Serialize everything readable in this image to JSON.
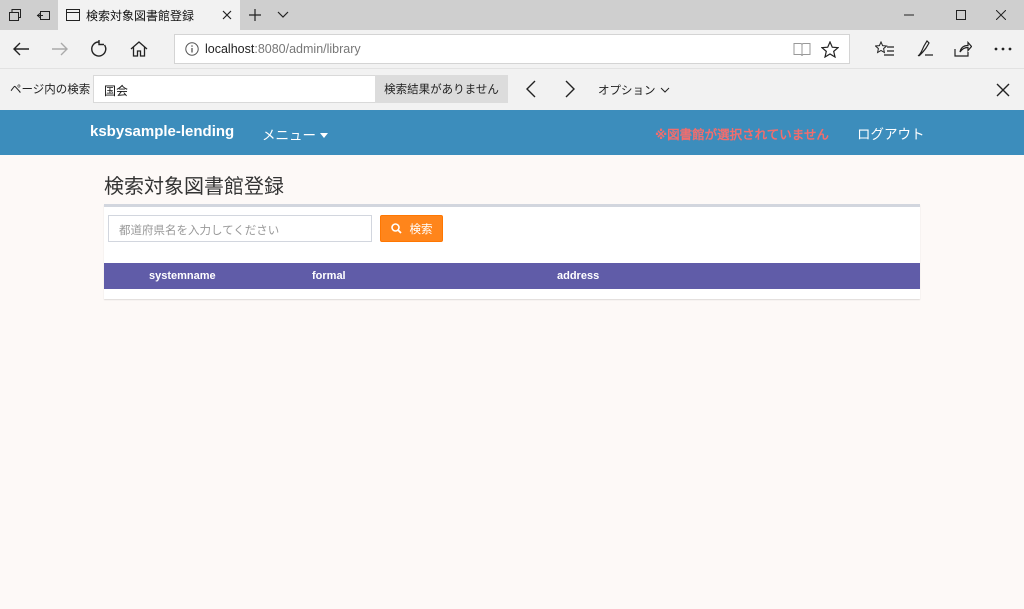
{
  "browser": {
    "tab_title": "検索対象図書館登録",
    "url_host": "localhost",
    "url_rest": ":8080/admin/library",
    "find": {
      "label": "ページ内の検索",
      "query": "国会",
      "result": "検索結果がありません",
      "options_label": "オプション"
    }
  },
  "app": {
    "brand": "ksbysample-lending",
    "menu_label": "メニュー",
    "warning": "※図書館が選択されていません",
    "logout": "ログアウト",
    "header_color": "#3c8dbc",
    "page_title": "検索対象図書館登録",
    "search": {
      "placeholder": "都道府県名を入力してください",
      "button_label": "検索",
      "button_color": "#ff851b"
    },
    "table": {
      "header_color": "#605ca8",
      "columns": [
        "systemname",
        "formal",
        "address"
      ],
      "rows": []
    }
  }
}
